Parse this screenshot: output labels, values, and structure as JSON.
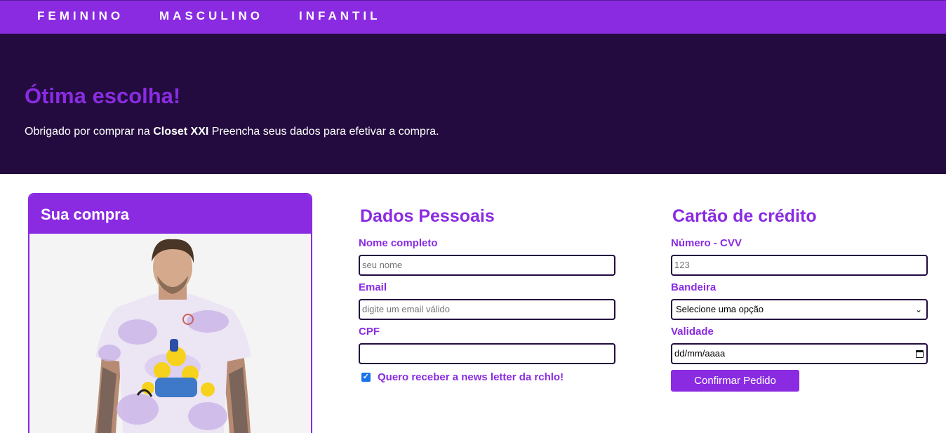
{
  "nav": {
    "items": [
      "FEMININO",
      "MASCULINO",
      "INFANTIL"
    ]
  },
  "hero": {
    "title": "Ótima escolha!",
    "text_before": "Obrigado por comprar na ",
    "brand": "Closet XXI",
    "text_after": " Preencha seus dados para efetivar a compra."
  },
  "purchase": {
    "title": "Sua compra",
    "image": "man-in-purple-tie-dye-tshirt-photo"
  },
  "personal": {
    "title": "Dados Pessoais",
    "name_label": "Nome completo",
    "name_placeholder": "seu nome",
    "email_label": "Email",
    "email_placeholder": "digite um email válido",
    "cpf_label": "CPF",
    "cpf_value": "",
    "newsletter_label": "Quero receber a news letter da rchlo!",
    "newsletter_checked": true
  },
  "card": {
    "title": "Cartão de crédito",
    "number_label": "Número - CVV",
    "number_placeholder": "123",
    "brand_label": "Bandeira",
    "brand_selected": "Selecione uma opção",
    "validity_label": "Validade",
    "validity_placeholder": "dd/mm/aaaa",
    "submit_label": "Confirmar Pedido"
  },
  "colors": {
    "accent": "#8a2be2",
    "hero_bg": "#230b3f",
    "field_border": "#230b3f"
  }
}
